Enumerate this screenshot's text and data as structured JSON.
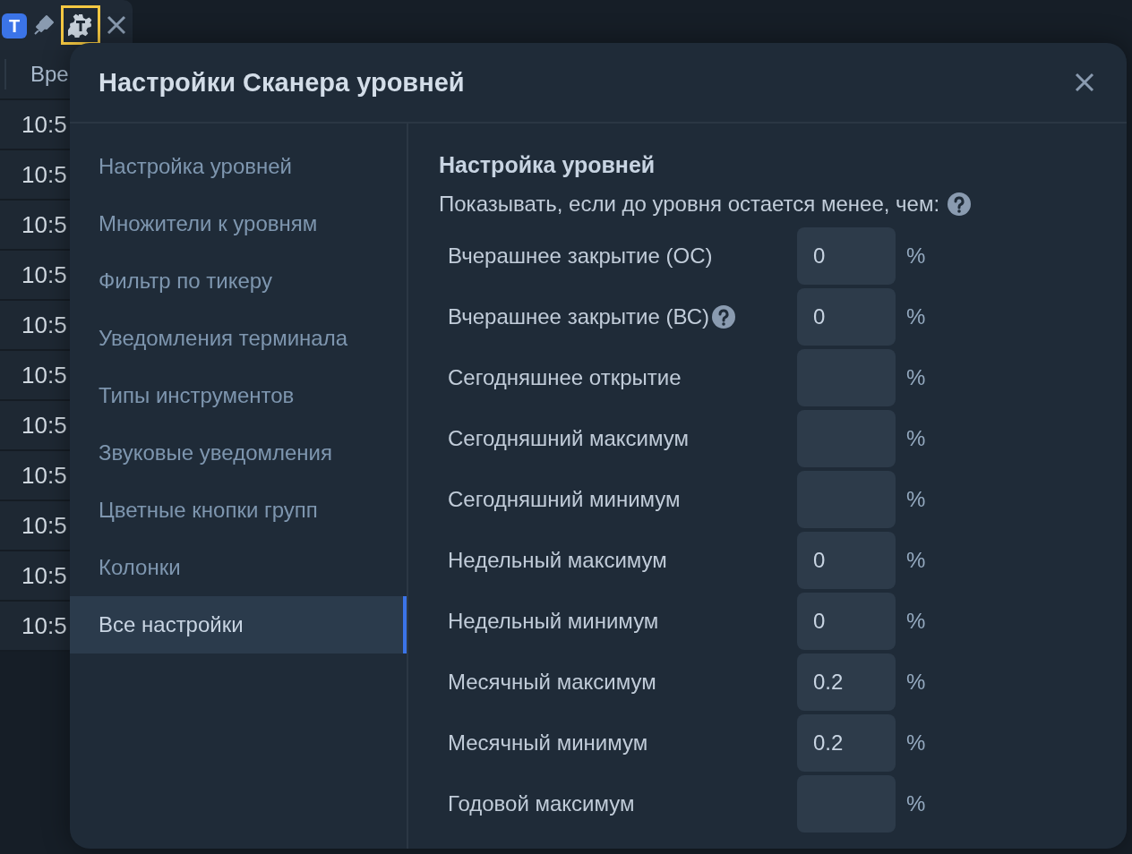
{
  "toolbar": {
    "badge": "T",
    "gear_highlighted": true
  },
  "table": {
    "column_1": "Вре",
    "rows": [
      "10:5",
      "10:5",
      "10:5",
      "10:5",
      "10:5",
      "10:5",
      "10:5",
      "10:5",
      "10:5",
      "10:5",
      "10:5"
    ]
  },
  "dialog": {
    "title": "Настройки Сканера уровней",
    "sidebar": {
      "items": [
        {
          "label": "Настройка уровней",
          "selected": false
        },
        {
          "label": "Множители к уровням",
          "selected": false
        },
        {
          "label": "Фильтр по тикеру",
          "selected": false
        },
        {
          "label": "Уведомления терминала",
          "selected": false
        },
        {
          "label": "Типы инструментов",
          "selected": false
        },
        {
          "label": "Звуковые уведомления",
          "selected": false
        },
        {
          "label": "Цветные кнопки групп",
          "selected": false
        },
        {
          "label": "Колонки",
          "selected": false
        },
        {
          "label": "Все настройки",
          "selected": true
        }
      ]
    },
    "section_title": "Настройка уровней",
    "prompt": "Показывать, если до уровня остается менее, чем:",
    "levels": [
      {
        "label": "Вчерашнее закрытие (ОС)",
        "value": "0",
        "unit": "%",
        "help": false
      },
      {
        "label": "Вчерашнее закрытие (ВС)",
        "value": "0",
        "unit": "%",
        "help": true
      },
      {
        "label": "Сегодняшнее открытие",
        "unit": "%",
        "help": false
      },
      {
        "label": "Сегодняшний максимум",
        "unit": "%",
        "help": false
      },
      {
        "label": "Сегодняшний минимум",
        "unit": "%",
        "help": false
      },
      {
        "label": "Недельный максимум",
        "value": "0",
        "unit": "%",
        "help": false
      },
      {
        "label": "Недельный минимум",
        "value": "0",
        "unit": "%",
        "help": false
      },
      {
        "label": "Месячный максимум",
        "value": "0.2",
        "unit": "%",
        "help": false
      },
      {
        "label": "Месячный минимум",
        "value": "0.2",
        "unit": "%",
        "help": false
      },
      {
        "label": "Годовой максимум",
        "unit": "%",
        "help": false
      }
    ]
  }
}
